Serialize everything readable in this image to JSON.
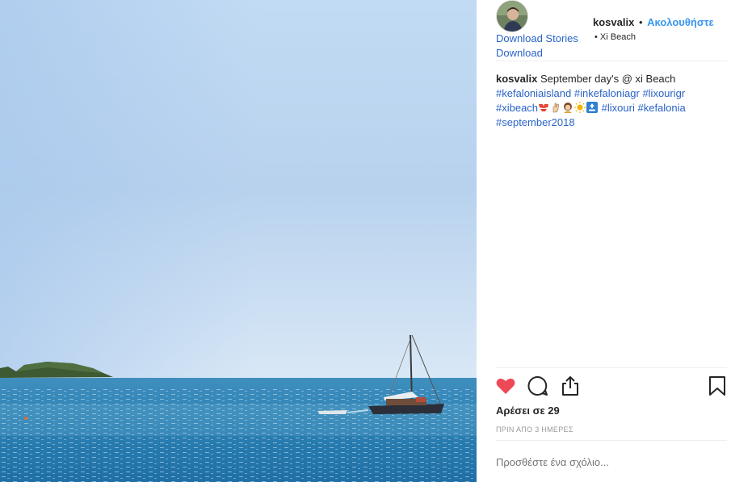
{
  "post": {
    "username": "kosvalix",
    "separator": "•",
    "follow_label": "Ακολουθήστε",
    "location": "• Xi Beach"
  },
  "links": {
    "download_stories": "Download Stories",
    "download": "Download"
  },
  "caption": {
    "username": "kosvalix",
    "text": "September day's @ xi Beach",
    "tags_line1": [
      "#kefaloniaisland",
      "#inkefaloniagr",
      "#lixourigr"
    ],
    "tag_xibeach": "#xibeach",
    "tags_line3": [
      "#lixouri",
      "#kefalonia"
    ],
    "tag_last": "#september2018"
  },
  "actions": {
    "like_icon": "heart-icon",
    "comment_icon": "comment-icon",
    "share_icon": "share-icon",
    "save_icon": "bookmark-icon"
  },
  "likes_label": "Αρέσει σε 29",
  "timestamp": "ΠΡΙΝ ΑΠΟ 3 ΗΜΕΡΕΣ",
  "comment_placeholder": "Προσθέστε ένα σχόλιο...",
  "colors": {
    "link": "#2a63c8",
    "follow": "#3897f0",
    "like": "#ed4956",
    "sea": "#2f88b8",
    "sky": "#b7d3ef"
  }
}
